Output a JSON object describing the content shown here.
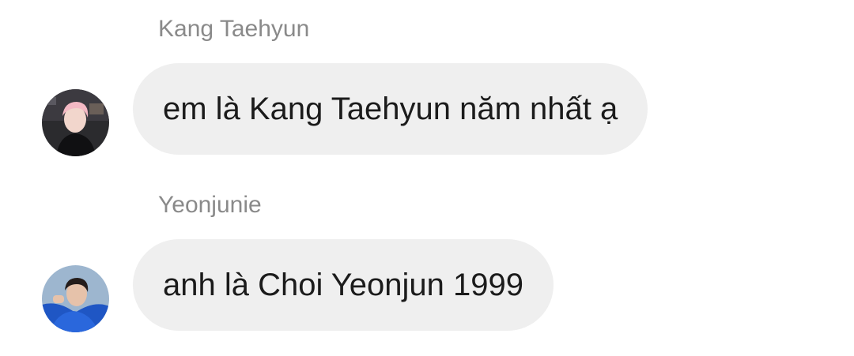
{
  "messages": [
    {
      "sender": "Kang Taehyun",
      "text": "em là Kang Taehyun năm nhất ạ",
      "avatar_icon": "profile-photo-pink-hair"
    },
    {
      "sender": "Yeonjunie",
      "text": "anh là Choi Yeonjun 1999",
      "avatar_icon": "profile-photo-blue-shirt"
    }
  ],
  "colors": {
    "bubble_bg": "#efefef",
    "sender_name": "#8a8a8a",
    "message_text": "#1b1b1b"
  }
}
